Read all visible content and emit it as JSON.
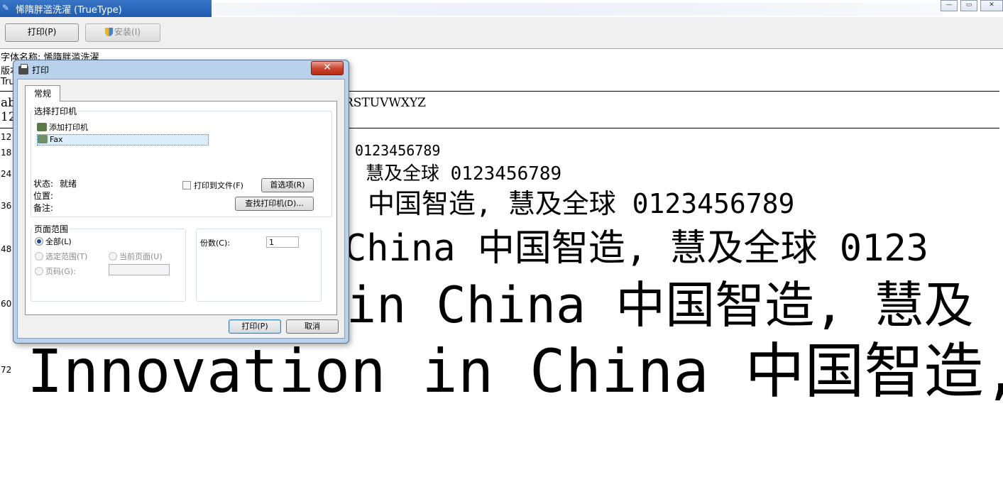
{
  "window": {
    "title": "悕隋胖滥洗濯 (TrueType)",
    "minimize_glyph": "—",
    "restore_glyph": "▭",
    "close_glyph": "✕"
  },
  "toolbar": {
    "print_label": "打印(P)",
    "install_label": "安装(I)"
  },
  "font_info": {
    "name_line": "字体名称: 悕隋胖滥洗濯",
    "version_line": "版本",
    "type_line": "Tru",
    "alpha_lower_fragment": "ab",
    "alpha_upper_fragment": "RSTUVWXYZ",
    "digits_fragment": "12"
  },
  "samples": [
    {
      "size": "12",
      "text": ""
    },
    {
      "size": "18",
      "text": "0123456789"
    },
    {
      "size": "24",
      "text": "慧及全球 0123456789"
    },
    {
      "size": "36",
      "text": "中国智造, 慧及全球 0123456789"
    },
    {
      "size": "48",
      "text": "China 中国智造, 慧及全球 0123"
    },
    {
      "size": "60",
      "text": "in China 中国智造, 慧及"
    },
    {
      "size": "72",
      "text": "Innovation in China 中国智造,"
    }
  ],
  "dialog": {
    "title": "打印",
    "close_glyph": "✕",
    "tab_general": "常规",
    "select_printer_label": "选择打印机",
    "printers": [
      "添加打印机",
      "Fax"
    ],
    "status_label": "状态:",
    "status_value": "就绪",
    "location_label": "位置:",
    "comment_label": "备注:",
    "print_to_file_label": "打印到文件(F)",
    "preferences_button": "首选项(R)",
    "find_printer_button": "查找打印机(D)...",
    "page_range_label": "页面范围",
    "range_all": "全部(L)",
    "range_selection": "选定范围(T)",
    "range_current": "当前页面(U)",
    "range_pages": "页码(G):",
    "copies_label": "份数(C):",
    "copies_value": "1",
    "print_button": "打印(P)",
    "cancel_button": "取消"
  }
}
